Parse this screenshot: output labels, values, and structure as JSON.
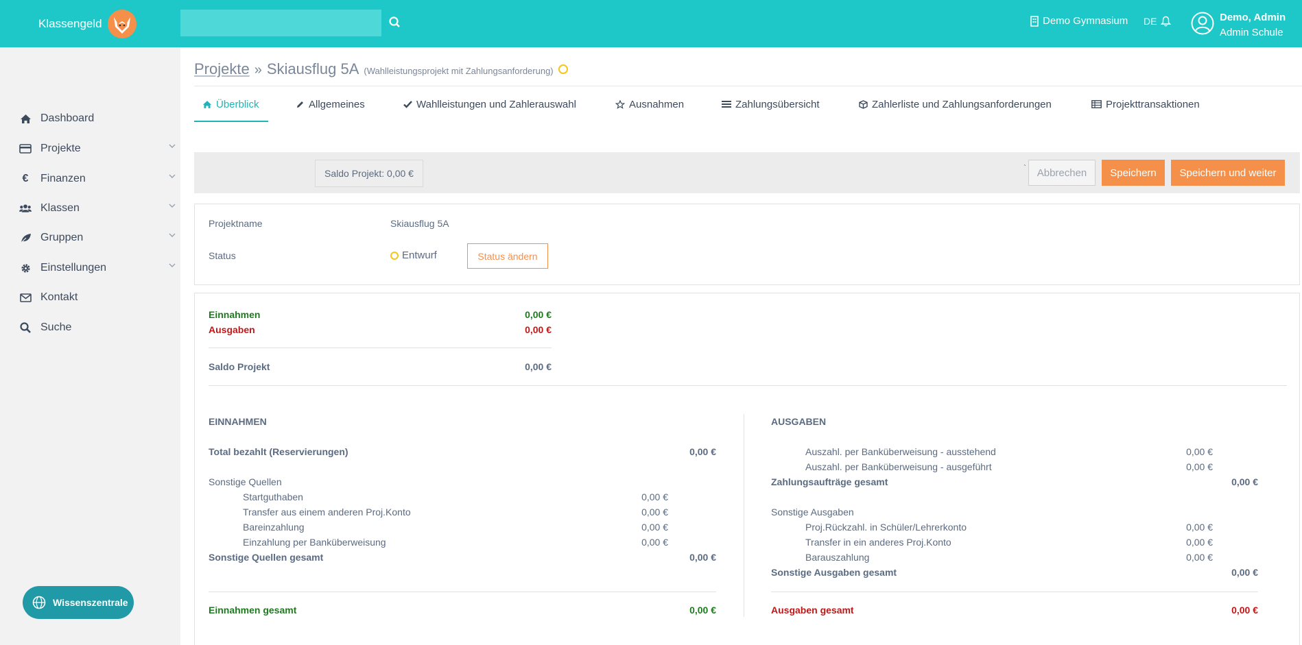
{
  "app": {
    "brand": "Klassengeld",
    "search_placeholder": "",
    "org": "Demo Gymnasium",
    "lang": "DE",
    "user_name": "Demo, Admin",
    "user_role": "Admin Schule"
  },
  "sidebar": {
    "items": [
      {
        "label": "Dashboard",
        "icon": "home-icon"
      },
      {
        "label": "Projekte",
        "icon": "credit-card-icon"
      },
      {
        "label": "Finanzen",
        "icon": "euro-icon"
      },
      {
        "label": "Klassen",
        "icon": "users-icon"
      },
      {
        "label": "Gruppen",
        "icon": "leaf-icon"
      },
      {
        "label": "Einstellungen",
        "icon": "gear-icon"
      },
      {
        "label": "Kontakt",
        "icon": "envelope-icon"
      },
      {
        "label": "Suche",
        "icon": "search-icon"
      }
    ],
    "help_button": "Wissenszentrale"
  },
  "breadcrumb": {
    "parent": "Projekte",
    "separator": "»",
    "title": "Skiausflug 5A",
    "subtitle": "(Wahlleistungsprojekt mit Zahlungsanforderung)"
  },
  "tabs": [
    {
      "label": "Überblick",
      "icon": "home-icon",
      "active": true
    },
    {
      "label": "Allgemeines",
      "icon": "pencil-icon"
    },
    {
      "label": "Wahlleistungen und Zahlerauswahl",
      "icon": "check-icon"
    },
    {
      "label": "Ausnahmen",
      "icon": "star-icon"
    },
    {
      "label": "Zahlungsübersicht",
      "icon": "list-icon"
    },
    {
      "label": "Zahlerliste und Zahlungsanforderungen",
      "icon": "box-icon"
    },
    {
      "label": "Projekttransaktionen",
      "icon": "table-icon"
    }
  ],
  "toolbar": {
    "saldo": "Saldo Projekt: 0,00 €",
    "tick": "`",
    "cancel": "Abbrechen",
    "save": "Speichern",
    "save_next": "Speichern und weiter"
  },
  "project": {
    "name_label": "Projektname",
    "name_value": "Skiausflug 5A",
    "status_label": "Status",
    "status_value": "Entwurf",
    "status_button": "Status ändern"
  },
  "summary": {
    "income_label": "Einnahmen",
    "income_value": "0,00 €",
    "expense_label": "Ausgaben",
    "expense_value": "0,00 €",
    "saldo_label": "Saldo Projekt",
    "saldo_value": "0,00 €"
  },
  "einnahmen": {
    "heading": "EINNAHMEN",
    "total_paid_label": "Total bezahlt (Reservierungen)",
    "total_paid_value": "0,00 €",
    "other_label": "Sonstige Quellen",
    "other_items": [
      {
        "label": "Startguthaben",
        "value": "0,00 €"
      },
      {
        "label": "Transfer aus einem anderen Proj.Konto",
        "value": "0,00 €"
      },
      {
        "label": "Bareinzahlung",
        "value": "0,00 €"
      },
      {
        "label": "Einzahlung per Banküberweisung",
        "value": "0,00 €"
      }
    ],
    "other_total_label": "Sonstige Quellen gesamt",
    "other_total_value": "0,00 €",
    "grand_label": "Einnahmen gesamt",
    "grand_value": "0,00 €"
  },
  "ausgaben": {
    "heading": "AUSGABEN",
    "payment_items": [
      {
        "label": "Auszahl. per Banküberweisung - ausstehend",
        "value": "0,00 €"
      },
      {
        "label": "Auszahl. per Banküberweisung - ausgeführt",
        "value": "0,00 €"
      }
    ],
    "payment_total_label": "Zahlungsaufträge gesamt",
    "payment_total_value": "0,00 €",
    "other_label": "Sonstige Ausgaben",
    "other_items": [
      {
        "label": "Proj.Rückzahl. in Schüler/Lehrerkonto",
        "value": "0,00 €"
      },
      {
        "label": "Transfer in ein anderes Proj.Konto",
        "value": "0,00 €"
      },
      {
        "label": "Barauszahlung",
        "value": "0,00 €"
      }
    ],
    "other_total_label": "Sonstige Ausgaben gesamt",
    "other_total_value": "0,00 €",
    "grand_label": "Ausgaben gesamt",
    "grand_value": "0,00 €"
  }
}
